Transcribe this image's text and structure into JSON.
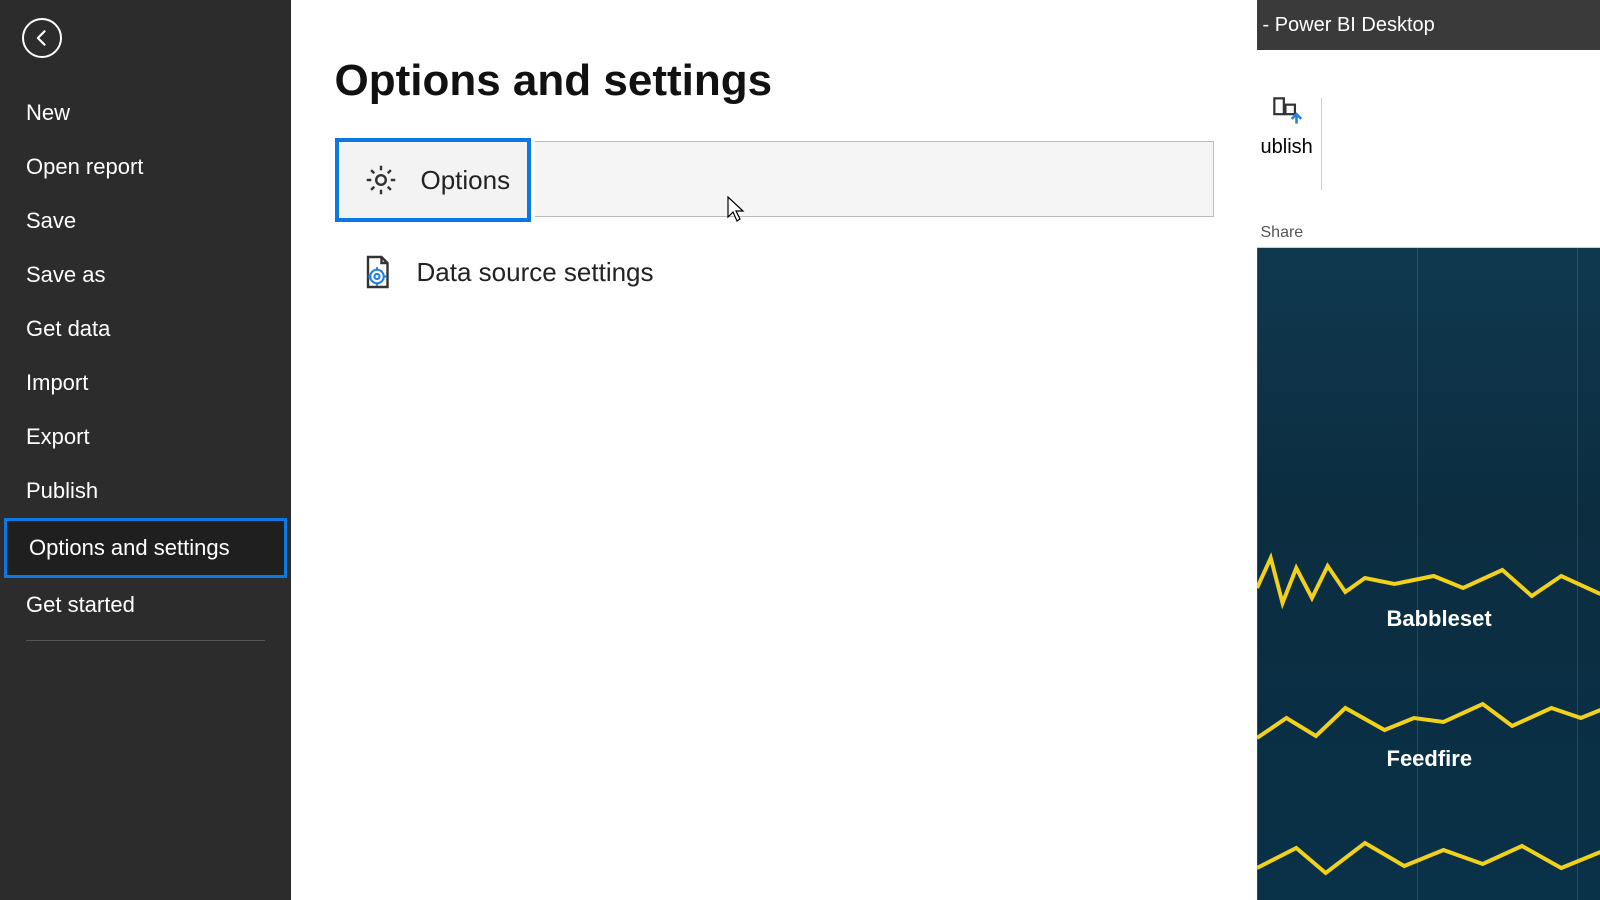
{
  "sidebar": {
    "items": [
      {
        "label": "New"
      },
      {
        "label": "Open report"
      },
      {
        "label": "Save"
      },
      {
        "label": "Save as"
      },
      {
        "label": "Get data"
      },
      {
        "label": "Import"
      },
      {
        "label": "Export"
      },
      {
        "label": "Publish"
      },
      {
        "label": "Options and settings",
        "selected": true
      },
      {
        "label": "Get started"
      }
    ]
  },
  "main": {
    "title": "Options and settings",
    "options": {
      "label": "Options"
    },
    "data_source": {
      "label": "Data source settings"
    }
  },
  "titlebar": {
    "text": "- Power BI Desktop"
  },
  "ribbon": {
    "publish_label": "ublish",
    "share_label": "Share"
  },
  "canvas": {
    "labels": [
      "Babbleset",
      "Feedfire"
    ]
  },
  "colors": {
    "highlight": "#0b78e3",
    "spark": "#f2d11a"
  }
}
